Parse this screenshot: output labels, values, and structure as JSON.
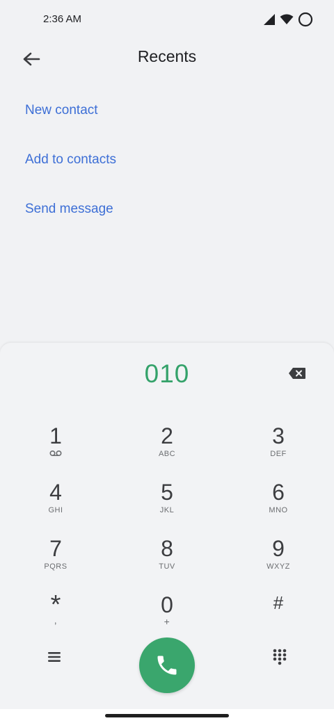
{
  "status": {
    "time": "2:36 AM"
  },
  "header": {
    "title": "Recents"
  },
  "actions": [
    {
      "label": "New contact"
    },
    {
      "label": "Add to contacts"
    },
    {
      "label": "Send message"
    }
  ],
  "dialer": {
    "number": "010",
    "keys": [
      {
        "digit": "1",
        "letters": ""
      },
      {
        "digit": "2",
        "letters": "ABC"
      },
      {
        "digit": "3",
        "letters": "DEF"
      },
      {
        "digit": "4",
        "letters": "GHI"
      },
      {
        "digit": "5",
        "letters": "JKL"
      },
      {
        "digit": "6",
        "letters": "MNO"
      },
      {
        "digit": "7",
        "letters": "PQRS"
      },
      {
        "digit": "8",
        "letters": "TUV"
      },
      {
        "digit": "9",
        "letters": "WXYZ"
      },
      {
        "digit": "*",
        "letters": ","
      },
      {
        "digit": "0",
        "letters": "+"
      },
      {
        "digit": "#",
        "letters": ""
      }
    ]
  },
  "colors": {
    "accent_link": "#3d6fd6",
    "dialed_number": "#34a26a",
    "call_button": "#3aa66d"
  },
  "icons": [
    "signal-icon",
    "wifi-icon",
    "battery-icon",
    "back-arrow-icon",
    "backspace-icon",
    "voicemail-icon",
    "menu-icon",
    "phone-icon",
    "dialpad-icon"
  ]
}
